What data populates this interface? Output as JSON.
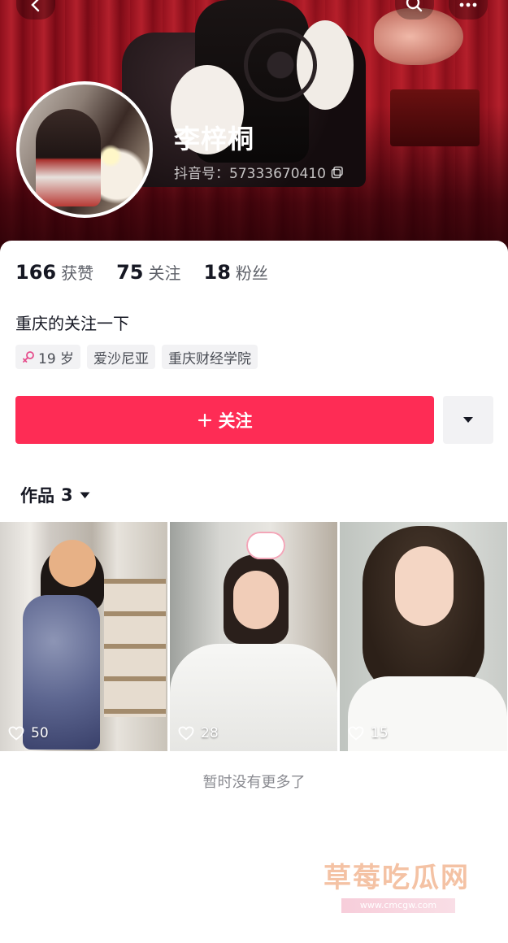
{
  "header": {
    "nickname": "李梓桐",
    "douyin_id": "抖音号：57333670410",
    "icons": [
      "back-icon",
      "search-icon",
      "more-icon",
      "copy-icon"
    ]
  },
  "stats": [
    {
      "value": "166",
      "label": "获赞"
    },
    {
      "value": "75",
      "label": "关注"
    },
    {
      "value": "18",
      "label": "粉丝"
    }
  ],
  "bio": "重庆的关注一下",
  "tags": [
    {
      "icon": "female-icon",
      "label": "19 岁"
    },
    {
      "label": "爱沙尼亚"
    },
    {
      "label": "重庆财经学院"
    }
  ],
  "actions": {
    "follow_label": "关注",
    "dropdown_icon": "caret-down-icon"
  },
  "works": {
    "label": "作品",
    "count": "3"
  },
  "videos": [
    {
      "likes": "50"
    },
    {
      "likes": "28"
    },
    {
      "likes": "15"
    }
  ],
  "footer": {
    "no_more": "暂时没有更多了"
  },
  "watermark": {
    "title": "草莓吃瓜网",
    "url": "www.cmcgw.com"
  },
  "colors": {
    "accent": "#fe2c55",
    "text": "#161823",
    "secondary_text": "#5c5f67"
  }
}
